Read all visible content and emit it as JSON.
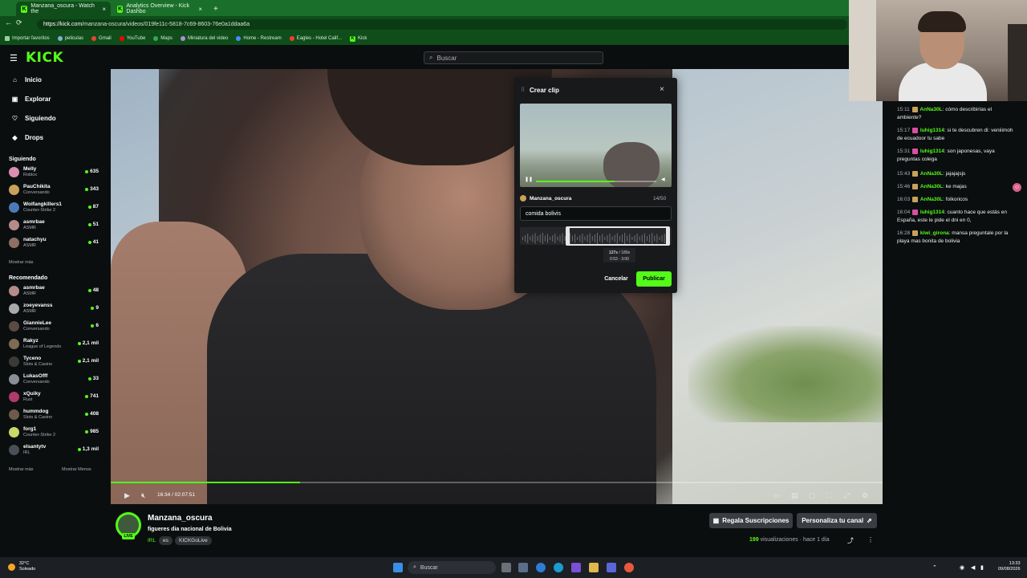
{
  "browser": {
    "tabs": [
      {
        "title": "Manzana_oscura - Watch the",
        "active": true
      },
      {
        "title": "Analytics Overview - Kick Dashbo",
        "active": false
      }
    ],
    "new_tab": "+",
    "url_domain": "https://kick.com",
    "url_path": "/manzana-oscura/videos/019fe11c-5818-7c69-8603-76e0a1ddaa6a",
    "bookmarks": [
      "Importar favoritos",
      "peliculas",
      "Gmail",
      "YouTube",
      "Maps",
      "Miniatura del video",
      "Home - Restream",
      "Eagles - Hotel Calif...",
      "Kick"
    ]
  },
  "site": {
    "logo": "KICK",
    "search_placeholder": "Buscar"
  },
  "sidebar": {
    "nav": [
      "Inicio",
      "Explorar",
      "Siguiendo",
      "Drops"
    ],
    "following_title": "Siguiendo",
    "following": [
      {
        "name": "Melly",
        "game": "Roblox",
        "viewers": "635",
        "color": "#d98fb0"
      },
      {
        "name": "PauChikita",
        "game": "Conversando",
        "viewers": "343",
        "color": "#c9a15a"
      },
      {
        "name": "Wolfangkillers1",
        "game": "Counter-Strike 2",
        "viewers": "87",
        "color": "#4a7bb8"
      },
      {
        "name": "asmrbae",
        "game": "ASMR",
        "viewers": "51",
        "color": "#b58a8a"
      },
      {
        "name": "natachyu",
        "game": "ASMR",
        "viewers": "41",
        "color": "#8f6f64"
      }
    ],
    "show_more_1": "Mostrar más",
    "recommended_title": "Recomendado",
    "recommended": [
      {
        "name": "asmrbae",
        "game": "ASMR",
        "viewers": "48",
        "color": "#b58a8a"
      },
      {
        "name": "zoeyevanss",
        "game": "ASMR",
        "viewers": "9",
        "color": "#a9a9a9"
      },
      {
        "name": "GiannieLee",
        "game": "Conversando",
        "viewers": "6",
        "color": "#5a4a44"
      },
      {
        "name": "Rakyz",
        "game": "League of Legends",
        "viewers": "2,1 mil",
        "color": "#7f6a52"
      },
      {
        "name": "Tyceno",
        "game": "Slots & Casino",
        "viewers": "2,1 mil",
        "color": "#3d3a36"
      },
      {
        "name": "LukasOfff",
        "game": "Conversando",
        "viewers": "33",
        "color": "#8a8f96"
      },
      {
        "name": "xQuiky",
        "game": "Rust",
        "viewers": "741",
        "color": "#b03a6a"
      },
      {
        "name": "hummdog",
        "game": "Slots & Casino",
        "viewers": "408",
        "color": "#6e5a4a"
      },
      {
        "name": "forg1",
        "game": "Counter-Strike 2",
        "viewers": "985",
        "color": "#c9d96a"
      },
      {
        "name": "elsantytv",
        "game": "IRL",
        "viewers": "1,3 mil",
        "color": "#4a4f55"
      }
    ],
    "show_more_2": "Mostrar más",
    "show_less": "Mostrar Menos"
  },
  "player": {
    "timecode": "16:34 / 02:07:51",
    "progress": 0.245
  },
  "clip_dialog": {
    "title": "Crear clip",
    "channel": "Manzana_oscura",
    "char_count": "14/50",
    "title_value": "comida bolivis",
    "tip_duration": "127s",
    "tip_max": "/ 180s",
    "tip_range": "0:53 - 3:00",
    "cancel": "Cancelar",
    "publish": "Publicar"
  },
  "chat": {
    "messages": [
      {
        "time": "15:11",
        "user": "AnNa30L",
        "user_color": "#53fc18",
        "badge": "#c9a15a",
        "text": "cómo describirías el ambiente?"
      },
      {
        "time": "15:17",
        "user": "luhig1314",
        "user_color": "#53fc18",
        "badge": "#d94fa0",
        "text": "si te descubren di: veniiimoh de ecuadoor tu sabe"
      },
      {
        "time": "15:31",
        "user": "luhig1314",
        "user_color": "#53fc18",
        "badge": "#d94fa0",
        "text": "son japonesas, vaya preguntas colega"
      },
      {
        "time": "15:43",
        "user": "AnNa30L",
        "user_color": "#53fc18",
        "badge": "#c9a15a",
        "text": "jajajajsjs"
      },
      {
        "time": "15:46",
        "user": "AnNa30L",
        "user_color": "#53fc18",
        "badge": "#c9a15a",
        "text": "ke majas"
      },
      {
        "time": "16:03",
        "user": "AnNa30L",
        "user_color": "#53fc18",
        "badge": "#c9a15a",
        "text": "folkoricos"
      },
      {
        "time": "16:04",
        "user": "luhig1314",
        "user_color": "#53fc18",
        "badge": "#d94fa0",
        "text": "cuanto hace que estás en España, este le pide el dni en 0,"
      },
      {
        "time": "16:28",
        "user": "kiwi_girona",
        "user_color": "#53fc18",
        "badge": "#c9a15a",
        "text": "mansa preguntale por la playa mas bonita de bolivia"
      }
    ]
  },
  "channel_info": {
    "name": "Manzana_oscura",
    "live_badge": "LIVE",
    "stream_title": "figueres dia nacional de Bolivia",
    "category": "IRL",
    "tags": [
      "es",
      "KICKGoLive"
    ],
    "gift_button": "Regala Suscripciones",
    "customize_button": "Personaliza tu canal",
    "views_count": "199",
    "views_label": "visualizaciones",
    "time_ago": "hace 1 día"
  },
  "taskbar": {
    "temperature": "32°C",
    "weather": "Soleado",
    "search": "Buscar",
    "time": "13:33",
    "date": "09/08/2026"
  }
}
